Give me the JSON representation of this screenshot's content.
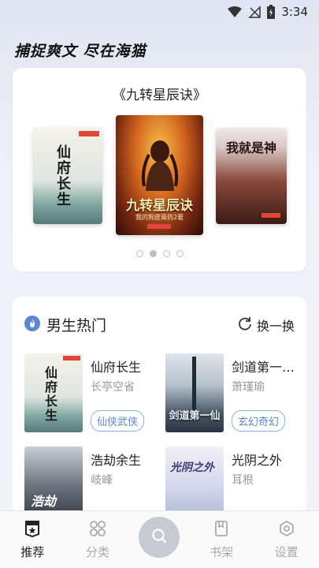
{
  "status_bar": {
    "time": "3:34"
  },
  "slogan": "捕捉爽文 尽在海猫",
  "featured": {
    "title": "《九转星辰诀》",
    "covers": [
      {
        "text": "仙府长生"
      },
      {
        "text": "九转星辰诀",
        "author": "我的狗皮膏药2著"
      },
      {
        "text": "我就是神"
      }
    ],
    "carousel_dots": 4,
    "active_dot": 1
  },
  "hot": {
    "title": "男生热门",
    "refresh_label": "换一换",
    "books": [
      {
        "title": "仙府长生",
        "author": "长亭空省",
        "tag": "仙侠武侠"
      },
      {
        "title": "剑道第一…",
        "author": "萧瑾瑜",
        "tag": "玄幻奇幻"
      },
      {
        "title": "浩劫余生",
        "author": "岐峰",
        "tag": ""
      },
      {
        "title": "光阴之外",
        "author": "耳根",
        "tag": ""
      }
    ]
  },
  "nav": {
    "items": [
      {
        "label": "推荐"
      },
      {
        "label": "分类"
      },
      {
        "label": "书架"
      },
      {
        "label": "设置"
      }
    ]
  },
  "colors": {
    "accent": "#5b86d6",
    "tag_border": "#8fb0e8",
    "nav_active": "#222222",
    "nav_inactive": "#aaaaaa"
  }
}
